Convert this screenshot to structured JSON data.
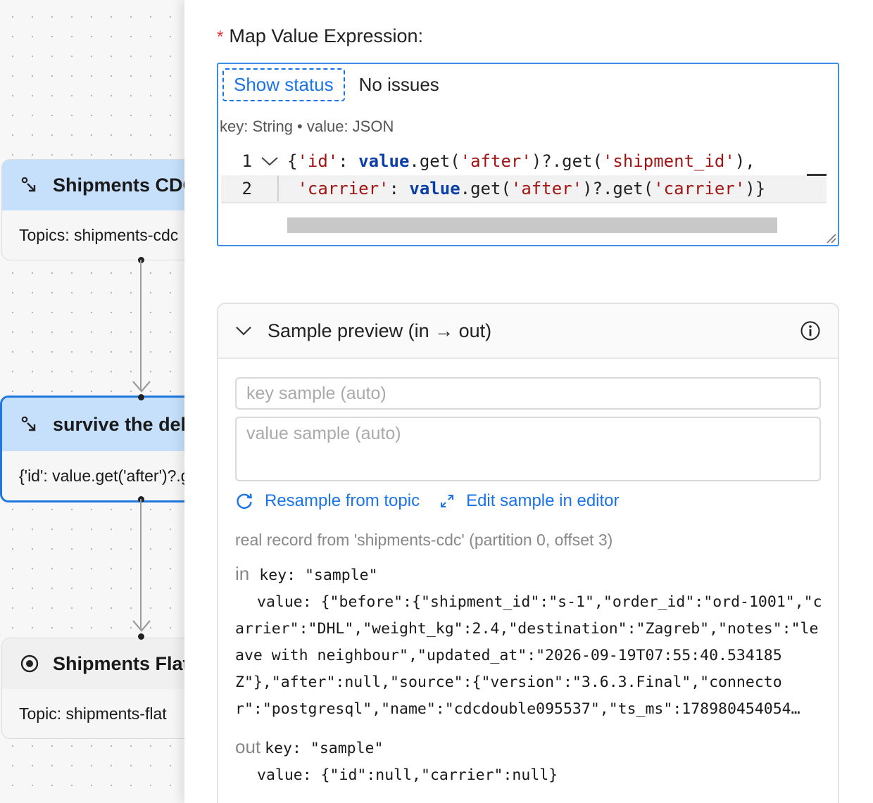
{
  "canvas": {
    "nodes": [
      {
        "title": "Shipments CDC",
        "body": "Topics: shipments-cdc"
      },
      {
        "title": "survive the delete",
        "body": "{'id': value.get('after')?.get('shipment_id'), 'carrier': value.get('after')?.get('carrier')}"
      },
      {
        "title": "Shipments Flat",
        "body": "Topic: shipments-flat"
      }
    ]
  },
  "panel": {
    "field_label": "Map Value Expression:",
    "required_mark": "*",
    "editor": {
      "show_status_label": "Show status",
      "status_text": "No issues",
      "type_hint": "key: String • value: JSON",
      "line_numbers": [
        "1",
        "2"
      ],
      "lines": [
        [
          "{",
          "'id'",
          ": ",
          "value",
          ".get(",
          "'after'",
          ")?.get(",
          "'shipment_id'",
          "),"
        ],
        [
          " ",
          "'carrier'",
          ": ",
          "value",
          ".get(",
          "'after'",
          ")?.get(",
          "'carrier'",
          ")}"
        ]
      ]
    },
    "preview": {
      "title": "Sample preview (in → out)",
      "key_placeholder": "key sample (auto)",
      "value_placeholder": "value sample (auto)",
      "resample_label": "Resample from topic",
      "edit_label": "Edit sample in editor",
      "source_note": "real record from 'shipments-cdc' (partition 0, offset 3)",
      "in": {
        "tag": "in",
        "key": "key: \"sample\"",
        "value": "value: {\"before\":{\"shipment_id\":\"s-1\",\"order_id\":\"ord-1001\",\"carrier\":\"DHL\",\"weight_kg\":2.4,\"destination\":\"Zagreb\",\"notes\":\"leave with neighbour\",\"updated_at\":\"2026-09-19T07:55:40.534185Z\"},\"after\":null,\"source\":{\"version\":\"3.6.3.Final\",\"connector\":\"postgresql\",\"name\":\"cdcdouble095537\",\"ts_ms\":178980454054…"
      },
      "out": {
        "tag": "out",
        "key": "key: \"sample\"",
        "value": "value: {\"id\":null,\"carrier\":null}"
      }
    }
  },
  "colors": {
    "accent": "#1a73e8",
    "node_header": "#c6e0fb",
    "selected_border": "#1f78e0",
    "string": "#a31515",
    "keyword": "#0b3fa7"
  }
}
